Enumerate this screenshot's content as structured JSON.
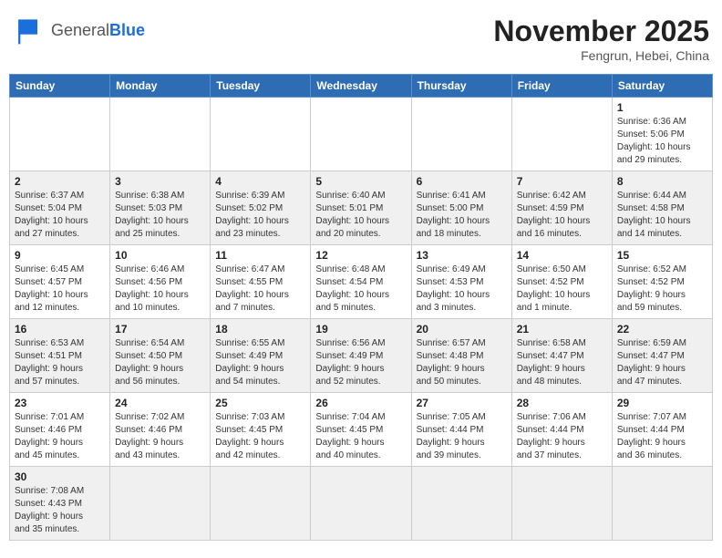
{
  "header": {
    "logo_general": "General",
    "logo_blue": "Blue",
    "month": "November 2025",
    "location": "Fengrun, Hebei, China"
  },
  "weekdays": [
    "Sunday",
    "Monday",
    "Tuesday",
    "Wednesday",
    "Thursday",
    "Friday",
    "Saturday"
  ],
  "rows": [
    {
      "shade": "white",
      "cells": [
        {
          "day": "",
          "info": ""
        },
        {
          "day": "",
          "info": ""
        },
        {
          "day": "",
          "info": ""
        },
        {
          "day": "",
          "info": ""
        },
        {
          "day": "",
          "info": ""
        },
        {
          "day": "",
          "info": ""
        },
        {
          "day": "1",
          "info": "Sunrise: 6:36 AM\nSunset: 5:06 PM\nDaylight: 10 hours\nand 29 minutes."
        }
      ]
    },
    {
      "shade": "gray",
      "cells": [
        {
          "day": "2",
          "info": "Sunrise: 6:37 AM\nSunset: 5:04 PM\nDaylight: 10 hours\nand 27 minutes."
        },
        {
          "day": "3",
          "info": "Sunrise: 6:38 AM\nSunset: 5:03 PM\nDaylight: 10 hours\nand 25 minutes."
        },
        {
          "day": "4",
          "info": "Sunrise: 6:39 AM\nSunset: 5:02 PM\nDaylight: 10 hours\nand 23 minutes."
        },
        {
          "day": "5",
          "info": "Sunrise: 6:40 AM\nSunset: 5:01 PM\nDaylight: 10 hours\nand 20 minutes."
        },
        {
          "day": "6",
          "info": "Sunrise: 6:41 AM\nSunset: 5:00 PM\nDaylight: 10 hours\nand 18 minutes."
        },
        {
          "day": "7",
          "info": "Sunrise: 6:42 AM\nSunset: 4:59 PM\nDaylight: 10 hours\nand 16 minutes."
        },
        {
          "day": "8",
          "info": "Sunrise: 6:44 AM\nSunset: 4:58 PM\nDaylight: 10 hours\nand 14 minutes."
        }
      ]
    },
    {
      "shade": "white",
      "cells": [
        {
          "day": "9",
          "info": "Sunrise: 6:45 AM\nSunset: 4:57 PM\nDaylight: 10 hours\nand 12 minutes."
        },
        {
          "day": "10",
          "info": "Sunrise: 6:46 AM\nSunset: 4:56 PM\nDaylight: 10 hours\nand 10 minutes."
        },
        {
          "day": "11",
          "info": "Sunrise: 6:47 AM\nSunset: 4:55 PM\nDaylight: 10 hours\nand 7 minutes."
        },
        {
          "day": "12",
          "info": "Sunrise: 6:48 AM\nSunset: 4:54 PM\nDaylight: 10 hours\nand 5 minutes."
        },
        {
          "day": "13",
          "info": "Sunrise: 6:49 AM\nSunset: 4:53 PM\nDaylight: 10 hours\nand 3 minutes."
        },
        {
          "day": "14",
          "info": "Sunrise: 6:50 AM\nSunset: 4:52 PM\nDaylight: 10 hours\nand 1 minute."
        },
        {
          "day": "15",
          "info": "Sunrise: 6:52 AM\nSunset: 4:52 PM\nDaylight: 9 hours\nand 59 minutes."
        }
      ]
    },
    {
      "shade": "gray",
      "cells": [
        {
          "day": "16",
          "info": "Sunrise: 6:53 AM\nSunset: 4:51 PM\nDaylight: 9 hours\nand 57 minutes."
        },
        {
          "day": "17",
          "info": "Sunrise: 6:54 AM\nSunset: 4:50 PM\nDaylight: 9 hours\nand 56 minutes."
        },
        {
          "day": "18",
          "info": "Sunrise: 6:55 AM\nSunset: 4:49 PM\nDaylight: 9 hours\nand 54 minutes."
        },
        {
          "day": "19",
          "info": "Sunrise: 6:56 AM\nSunset: 4:49 PM\nDaylight: 9 hours\nand 52 minutes."
        },
        {
          "day": "20",
          "info": "Sunrise: 6:57 AM\nSunset: 4:48 PM\nDaylight: 9 hours\nand 50 minutes."
        },
        {
          "day": "21",
          "info": "Sunrise: 6:58 AM\nSunset: 4:47 PM\nDaylight: 9 hours\nand 48 minutes."
        },
        {
          "day": "22",
          "info": "Sunrise: 6:59 AM\nSunset: 4:47 PM\nDaylight: 9 hours\nand 47 minutes."
        }
      ]
    },
    {
      "shade": "white",
      "cells": [
        {
          "day": "23",
          "info": "Sunrise: 7:01 AM\nSunset: 4:46 PM\nDaylight: 9 hours\nand 45 minutes."
        },
        {
          "day": "24",
          "info": "Sunrise: 7:02 AM\nSunset: 4:46 PM\nDaylight: 9 hours\nand 43 minutes."
        },
        {
          "day": "25",
          "info": "Sunrise: 7:03 AM\nSunset: 4:45 PM\nDaylight: 9 hours\nand 42 minutes."
        },
        {
          "day": "26",
          "info": "Sunrise: 7:04 AM\nSunset: 4:45 PM\nDaylight: 9 hours\nand 40 minutes."
        },
        {
          "day": "27",
          "info": "Sunrise: 7:05 AM\nSunset: 4:44 PM\nDaylight: 9 hours\nand 39 minutes."
        },
        {
          "day": "28",
          "info": "Sunrise: 7:06 AM\nSunset: 4:44 PM\nDaylight: 9 hours\nand 37 minutes."
        },
        {
          "day": "29",
          "info": "Sunrise: 7:07 AM\nSunset: 4:44 PM\nDaylight: 9 hours\nand 36 minutes."
        }
      ]
    },
    {
      "shade": "gray",
      "cells": [
        {
          "day": "30",
          "info": "Sunrise: 7:08 AM\nSunset: 4:43 PM\nDaylight: 9 hours\nand 35 minutes."
        },
        {
          "day": "",
          "info": ""
        },
        {
          "day": "",
          "info": ""
        },
        {
          "day": "",
          "info": ""
        },
        {
          "day": "",
          "info": ""
        },
        {
          "day": "",
          "info": ""
        },
        {
          "day": "",
          "info": ""
        }
      ]
    }
  ]
}
